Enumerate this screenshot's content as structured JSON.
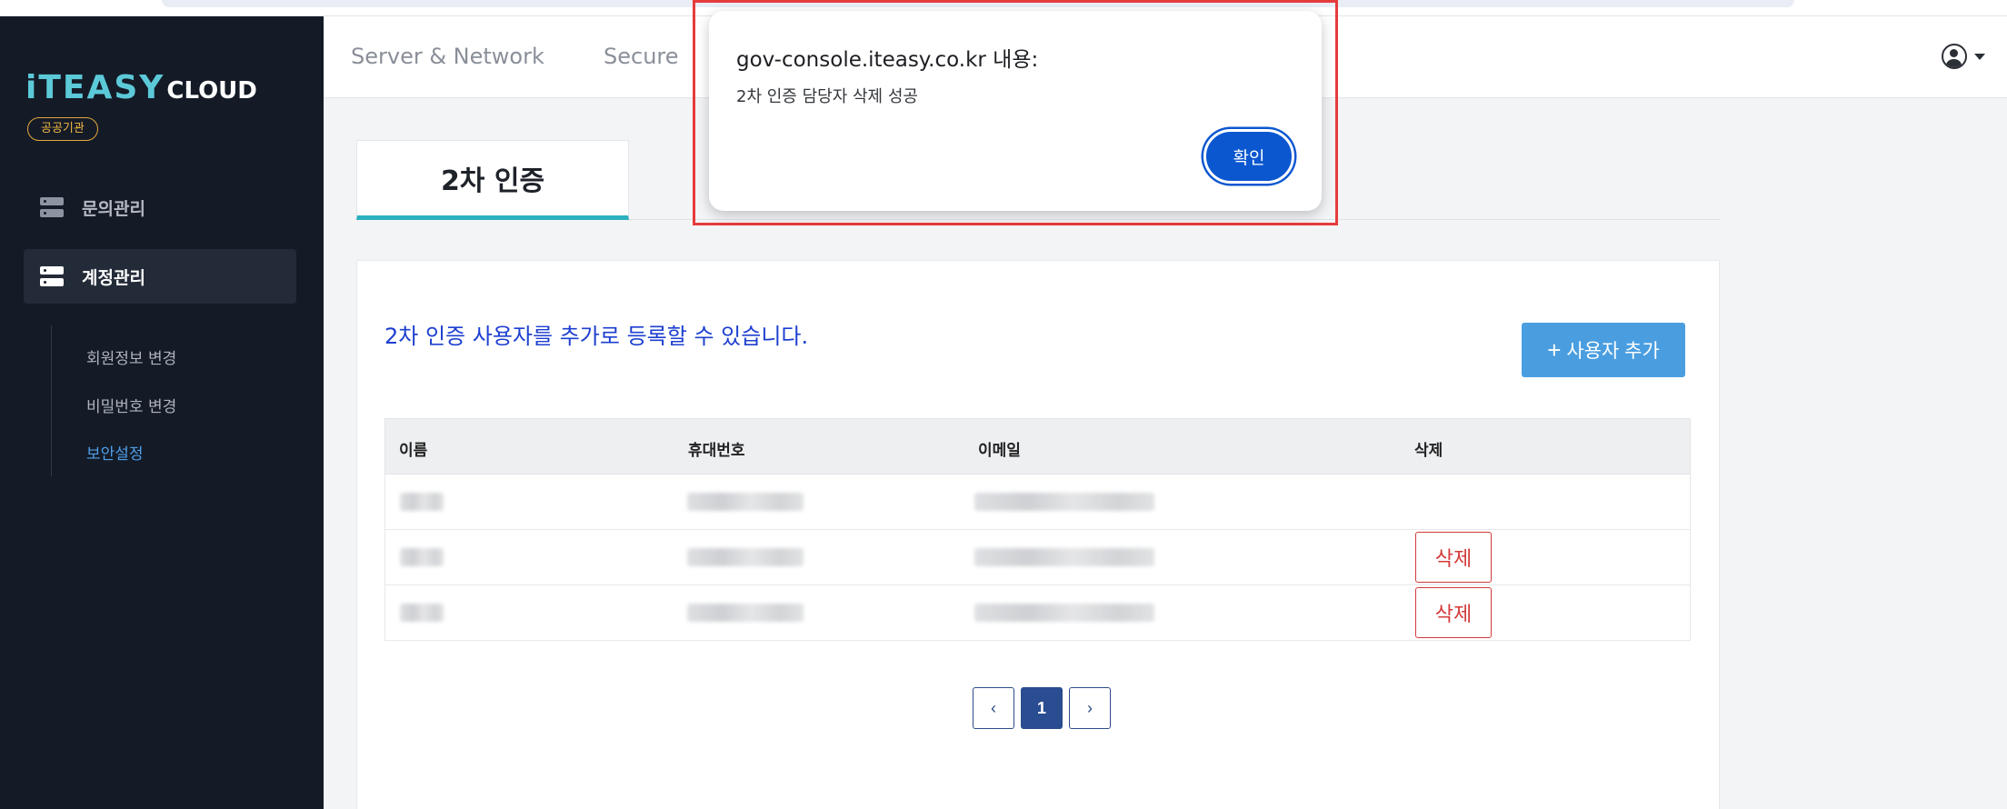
{
  "sidebar": {
    "logo_main": "iTEASY",
    "logo_sub": "CLOUD",
    "badge": "공공기관",
    "items": [
      {
        "label": "문의관리"
      },
      {
        "label": "계정관리"
      }
    ],
    "sub_items": [
      {
        "label": "회원정보 변경"
      },
      {
        "label": "비밀번호 변경"
      },
      {
        "label": "보안설정"
      }
    ]
  },
  "header": {
    "nav": [
      {
        "label": "Server & Network"
      },
      {
        "label": "Secure"
      }
    ]
  },
  "tab": {
    "label": "2차 인증"
  },
  "content": {
    "description": "2차 인증 사용자를 추가로 등록할 수 있습니다.",
    "add_button": "사용자 추가",
    "add_plus": "+"
  },
  "table": {
    "columns": [
      "이름",
      "휴대번호",
      "이메일",
      "삭제"
    ],
    "delete_label": "삭제"
  },
  "pagination": {
    "prev": "‹",
    "current": "1",
    "next": "›"
  },
  "dialog": {
    "title": "gov-console.iteasy.co.kr 내용:",
    "message": "2차 인증 담당자 삭제 성공",
    "ok": "확인"
  },
  "colors": {
    "sidebar_bg": "#141b27",
    "accent_teal": "#2bb0bf",
    "primary_blue": "#0b57d0",
    "delete_red": "#d33a3a",
    "highlight_red": "#e63b3b"
  }
}
